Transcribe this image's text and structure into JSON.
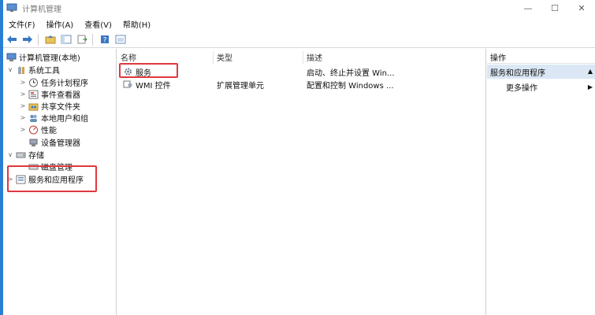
{
  "window": {
    "title": "计算机管理",
    "minimize_glyph": "—",
    "maximize_glyph": "☐",
    "close_glyph": "✕"
  },
  "menu": [
    {
      "label": "文件(F)"
    },
    {
      "label": "操作(A)"
    },
    {
      "label": "查看(V)"
    },
    {
      "label": "帮助(H)"
    }
  ],
  "toolbar": {
    "icons": [
      "back-arrow-icon",
      "forward-arrow-icon",
      "up-folder-icon",
      "console-tree-icon",
      "export-list-icon",
      "help-icon",
      "properties-icon"
    ]
  },
  "tree": {
    "root": {
      "label": "计算机管理(本地)"
    },
    "items": [
      {
        "label": "系统工具",
        "toggle": "∨",
        "level": 1,
        "icon": "tools-icon"
      },
      {
        "label": "任务计划程序",
        "toggle": ">",
        "level": 2,
        "icon": "clock-icon"
      },
      {
        "label": "事件查看器",
        "toggle": ">",
        "level": 2,
        "icon": "event-viewer-icon"
      },
      {
        "label": "共享文件夹",
        "toggle": ">",
        "level": 2,
        "icon": "shared-folder-icon"
      },
      {
        "label": "本地用户和组",
        "toggle": ">",
        "level": 2,
        "icon": "users-icon"
      },
      {
        "label": "性能",
        "toggle": ">",
        "level": 2,
        "icon": "performance-icon"
      },
      {
        "label": "设备管理器",
        "toggle": "",
        "level": 2,
        "icon": "device-manager-icon"
      },
      {
        "label": "存储",
        "toggle": "∨",
        "level": 1,
        "icon": "storage-icon"
      },
      {
        "label": "磁盘管理",
        "toggle": "",
        "level": 2,
        "icon": "disk-icon"
      },
      {
        "label": "服务和应用程序",
        "toggle": ">",
        "level": 1,
        "icon": "services-apps-icon"
      }
    ]
  },
  "list": {
    "columns": [
      "名称",
      "类型",
      "描述"
    ],
    "rows": [
      {
        "name": "服务",
        "type": "",
        "description": "启动、终止并设置 Win...",
        "icon": "gear-icon"
      },
      {
        "name": "WMI 控件",
        "type": "扩展管理单元",
        "description": "配置和控制 Windows ...",
        "icon": "wmi-icon"
      }
    ]
  },
  "actions": {
    "title": "操作",
    "section": "服务和应用程序",
    "section_caret": "▲",
    "item": "更多操作",
    "item_caret": "▶"
  },
  "colors": {
    "highlight_red": "#e0383e",
    "section_bg": "#dbe7f5",
    "desktop_blue": "#2a7fd4"
  }
}
